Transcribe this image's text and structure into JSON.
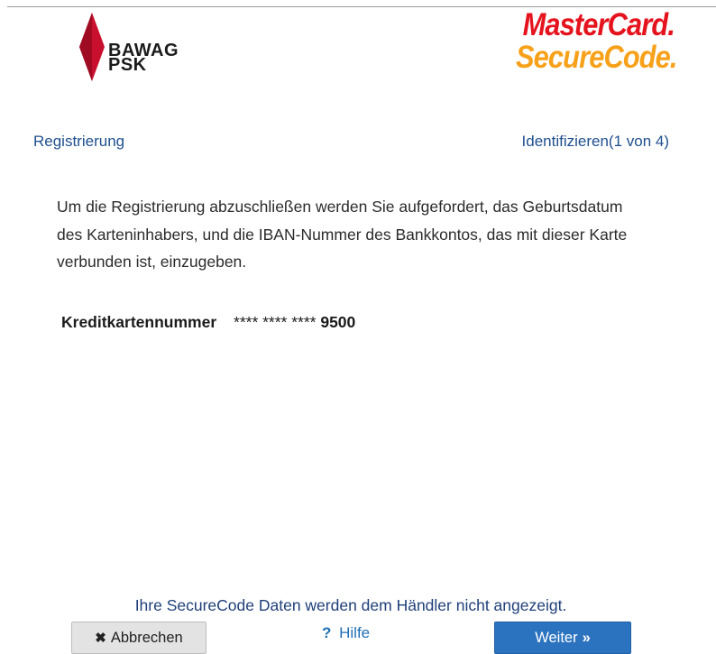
{
  "logos": {
    "bank_name_line1": "BAWAG",
    "bank_name_line2": "PSK",
    "brand_line1": "MasterCard.",
    "brand_line2": "SecureCode."
  },
  "header": {
    "section": "Registrierung",
    "step": "Identifizieren(1 von 4)"
  },
  "intro": {
    "text": "Um die Registrierung abzuschließen werden Sie aufgefordert, das Geburtsdatum des Karteninhabers, und die IBAN-Nummer des Bankkontos, das mit dieser Karte verbunden ist, einzugeben."
  },
  "card": {
    "label": "Kreditkartennummer",
    "masked": "**** **** ****",
    "last_digits": "9500"
  },
  "footer": {
    "notice": "Ihre SecureCode Daten werden dem Händler nicht angezeigt.",
    "cancel_label": "Abbrechen",
    "help_label": "Hilfe",
    "next_label": "Weiter"
  },
  "icons": {
    "cancel": "close-icon",
    "help": "question-mark-icon",
    "next": "double-chevron-right-icon"
  },
  "colors": {
    "link_blue": "#1f4f8f",
    "primary_button": "#2b73bf",
    "mastercard_red": "#e5131d",
    "securecode_orange": "#f7a11a",
    "bawag_red": "#c8102e"
  }
}
